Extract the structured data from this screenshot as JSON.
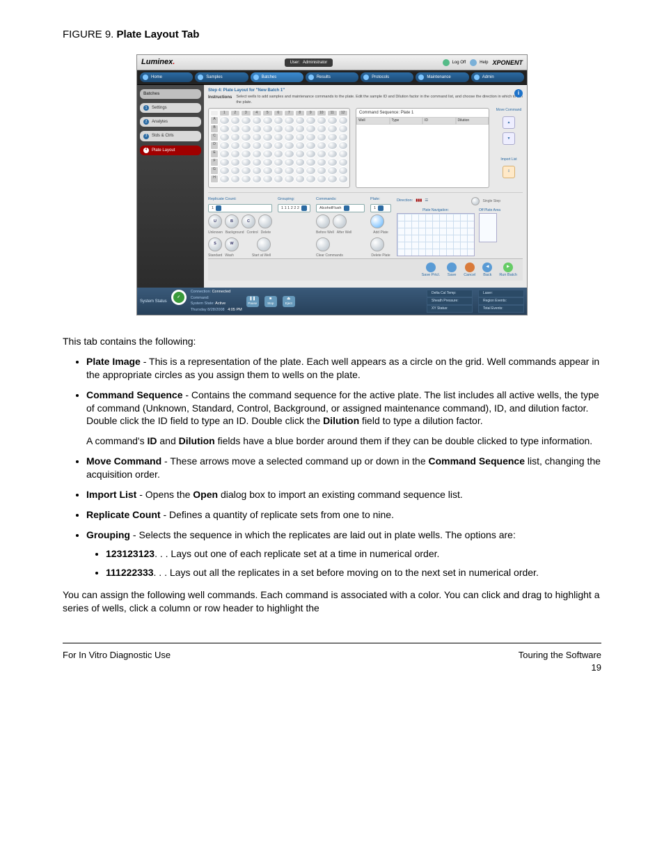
{
  "figure": {
    "label": "FIGURE 9.",
    "name": "Plate Layout Tab"
  },
  "app": {
    "brand": "Luminex",
    "user_label": "User:",
    "user_value": "Administrator",
    "logoff": "Log Off",
    "help": "Help",
    "product": "XPONENT",
    "nav": {
      "home": "Home",
      "samples": "Samples",
      "batches": "Batches",
      "results": "Results",
      "protocols": "Protocols",
      "maintenance": "Maintenance",
      "admin": "Admin"
    },
    "sidebar": {
      "header": "Batches",
      "items": [
        {
          "num": "1",
          "label": "Settings"
        },
        {
          "num": "2",
          "label": "Analytes"
        },
        {
          "num": "3",
          "label": "Stds & Ctrls"
        },
        {
          "num": "4",
          "label": "Plate Layout"
        }
      ]
    },
    "step_header": "Step 4: Plate Layout for \"New Batch 1\"",
    "instructions_label": "Instructions",
    "instructions_text": "Select wells to add samples and maintenance commands to the plate. Edit the sample ID and Dilution factor in the command list, and choose the direction in which to run the plate.",
    "plate_cols": [
      "1",
      "2",
      "3",
      "4",
      "5",
      "6",
      "7",
      "8",
      "9",
      "10",
      "11",
      "12"
    ],
    "plate_rows": [
      "A",
      "B",
      "C",
      "D",
      "E",
      "F",
      "G",
      "H"
    ],
    "seq": {
      "title": "Command Sequence: Plate 1",
      "cols": {
        "well": "Well",
        "type": "Type",
        "id": "ID",
        "dilution": "Dilution"
      }
    },
    "sidebtns": {
      "move": "Move Command",
      "import": "Import List"
    },
    "lower": {
      "replicate_label": "Replicate Count:",
      "replicate_value": "1",
      "grouping_label": "Grouping:",
      "grouping_value": "1 1 1 2 2 2",
      "commands_label": "Commands:",
      "commands_value": "AlcoholFlush",
      "plate_label": "Plate:",
      "plate_value": "1",
      "well_buttons": {
        "u": "U",
        "b": "B",
        "c": "C",
        "s": "S",
        "w": "W",
        "unknown": "Unknown",
        "background": "Background",
        "control": "Control",
        "delete": "Delete",
        "standard": "Standard",
        "wash": "Wash",
        "startat": "Start at Well",
        "before": "Before Well",
        "after": "After Well",
        "clear": "Clear Commands",
        "addplate": "Add Plate",
        "delplate": "Delete Plate"
      },
      "direction_label": "Direction:",
      "platenav_label": "Plate Navigation:",
      "offplate_label": "Off Plate Area",
      "single": "Single Step"
    },
    "footer_actions": {
      "saveprtcl": "Save Prtcl.",
      "save": "Save",
      "cancel": "Cancel",
      "back": "Back",
      "run": "Run Batch"
    },
    "status": {
      "label": "System Status",
      "connection_k": "Connection:",
      "connection_v": "Connected",
      "command_k": "Command:",
      "command_v": "",
      "state_k": "System State:",
      "state_v": "Active",
      "date": "Thursday 8/28/2008",
      "time": "4:05 PM",
      "mini": {
        "pause": "Pause",
        "stop": "Stop",
        "eject": "Eject"
      },
      "dcal": "Delta Cal Temp:",
      "sheath": "Sheath Pressure:",
      "xy": "XY Status:",
      "laser": "Laser:",
      "region": "Region Events:",
      "total": "Total Events:"
    }
  },
  "body": {
    "lead": "This tab contains the following:",
    "items": {
      "plate_image_t": "Plate Image",
      "plate_image": " - This is a representation of the plate. Each well appears as a circle on the grid. Well commands appear in the appropriate circles as you assign them to wells on the plate.",
      "cmdseq_t": "Command Sequence",
      "cmdseq": " - Contains the command sequence for the active plate. The list includes all active wells, the type of command (Unknown, Standard, Control, Background, or assigned maintenance command), ID, and dilution factor. Double click the ID field to type an ID. Double click the ",
      "cmdseq_dil_t": "Dilution",
      "cmdseq_tail": " field to type a dilution factor.",
      "cmdseq_p2a": "A command's ",
      "cmdseq_p2b": "ID",
      "cmdseq_p2c": " and ",
      "cmdseq_p2d": "Dilution",
      "cmdseq_p2e": " fields have a blue border around them if they can be double clicked to type information.",
      "move_t": "Move Command",
      "move_a": " - These arrows move a selected command up or down in the ",
      "move_b": "Command Sequence",
      "move_c": " list, changing the acquisition order.",
      "import_t": "Import List",
      "import_a": " - Opens the ",
      "import_b": "Open",
      "import_c": " dialog box to import an existing command sequence list.",
      "rep_t": "Replicate Count",
      "rep": " - Defines a quantity of replicate sets from one to nine.",
      "grp_t": "Grouping",
      "grp": " - Selects the sequence in which the replicates are laid out in plate wells. The options are:",
      "g1_t": "123123123",
      "g1": ". . . Lays out one of each replicate set at a time in numerical order.",
      "g2_t": "111222333",
      "g2": ". . . Lays out all the replicates in a set before moving on to the next set in numerical order."
    },
    "closing": "You can assign the following well commands. Each command is associated with a color. You can click and drag to highlight a series of wells, click a column or row header to highlight the"
  },
  "footer": {
    "left": "For In Vitro Diagnostic Use",
    "right_top": "Touring the Software",
    "right_bottom": "19"
  },
  "icons": {
    "up": "▲",
    "down": "▼",
    "check": "✓",
    "pause": "❚❚",
    "stop": "■",
    "eject": "⏏",
    "play": "▶",
    "left": "◀"
  }
}
